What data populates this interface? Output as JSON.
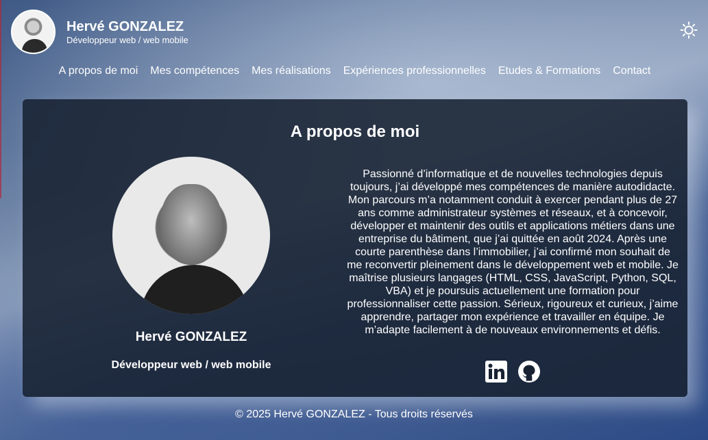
{
  "header": {
    "name": "Hervé GONZALEZ",
    "subtitle": "Développeur web / web mobile",
    "theme_icon": "sun-icon"
  },
  "nav": {
    "items": [
      {
        "label": "A propos de moi"
      },
      {
        "label": "Mes compétences"
      },
      {
        "label": "Mes réalisations"
      },
      {
        "label": "Expériences professionnelles"
      },
      {
        "label": "Etudes & Formations"
      },
      {
        "label": "Contact"
      }
    ]
  },
  "about": {
    "title": "A propos de moi",
    "profile_name": "Hervé GONZALEZ",
    "profile_role": "Développeur web / web mobile",
    "bio": "Passionné d’informatique et de nouvelles technologies depuis toujours, j’ai développé mes compétences de manière autodidacte. Mon parcours m’a notamment conduit à exercer pendant plus de 27 ans comme administrateur systèmes et réseaux, et à concevoir, développer et maintenir des outils et applications métiers dans une entreprise du bâtiment, que j’ai quittée en août 2024. Après une courte parenthèse dans l’immobilier, j’ai confirmé mon souhait de me reconvertir pleinement dans le développement web et mobile. Je maîtrise plusieurs langages (HTML, CSS, JavaScript, Python, SQL, VBA) et je poursuis actuellement une formation pour professionnaliser cette passion. Sérieux, rigoureux et curieux, j’aime apprendre, partager mon expérience et travailler en équipe. Je m’adapte facilement à de nouveaux environnements et défis.",
    "socials": [
      "linkedin-icon",
      "github-icon"
    ]
  },
  "footer": {
    "text": "© 2025 Hervé GONZALEZ - Tous droits réservés"
  },
  "colors": {
    "card_background": "#182232",
    "text": "#ffffff"
  }
}
